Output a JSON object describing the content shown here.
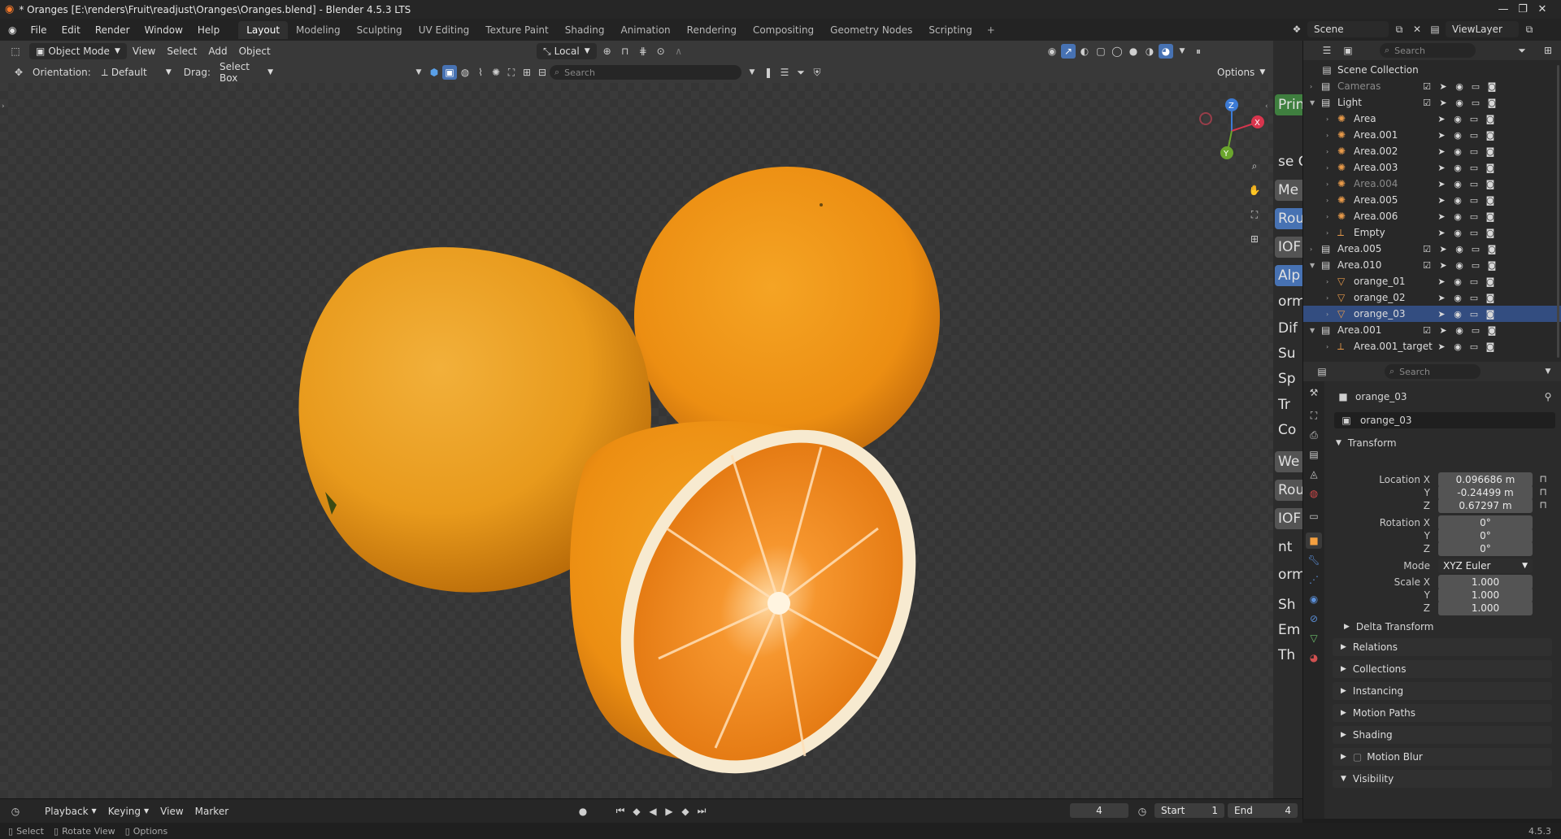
{
  "window": {
    "title": "* Oranges [E:\\renders\\Fruit\\readjust\\Oranges\\Oranges.blend] - Blender 4.5.3 LTS"
  },
  "menu": [
    "File",
    "Edit",
    "Render",
    "Window",
    "Help"
  ],
  "workspaces": [
    "Layout",
    "Modeling",
    "Sculpting",
    "UV Editing",
    "Texture Paint",
    "Shading",
    "Animation",
    "Rendering",
    "Compositing",
    "Geometry Nodes",
    "Scripting"
  ],
  "active_workspace": "Layout",
  "topright": {
    "scene": "Scene",
    "view_layer": "ViewLayer"
  },
  "viewport": {
    "mode": "Object Mode",
    "menus": [
      "View",
      "Select",
      "Add",
      "Object"
    ],
    "transform_space": "Local",
    "orientation_label": "Orientation:",
    "orientation": "Default",
    "drag_label": "Drag:",
    "drag": "Select Box",
    "search_placeholder": "Search",
    "options": "Options",
    "gizmo": {
      "x": "X",
      "y": "Y",
      "z": "Z"
    }
  },
  "npanel_tabs": [
    "Prin",
    "se C",
    "Me",
    "Rou",
    "IOF",
    "Alp",
    "orma",
    "Dif",
    "Su",
    "Sp",
    "Tr",
    "Co",
    "We",
    "Rou",
    "IOF",
    "nt",
    "orma",
    "Sh",
    "Em",
    "Th"
  ],
  "outliner": {
    "search_placeholder": "Search",
    "root": "Scene Collection",
    "rows": [
      {
        "label": "Cameras",
        "depth": 0,
        "kind": "collection",
        "dim": true
      },
      {
        "label": "Light",
        "depth": 0,
        "kind": "collection",
        "expanded": true
      },
      {
        "label": "Area",
        "depth": 1,
        "kind": "light"
      },
      {
        "label": "Area.001",
        "depth": 1,
        "kind": "light"
      },
      {
        "label": "Area.002",
        "depth": 1,
        "kind": "light"
      },
      {
        "label": "Area.003",
        "depth": 1,
        "kind": "light"
      },
      {
        "label": "Area.004",
        "depth": 1,
        "kind": "light",
        "dim": true
      },
      {
        "label": "Area.005",
        "depth": 1,
        "kind": "light"
      },
      {
        "label": "Area.006",
        "depth": 1,
        "kind": "light"
      },
      {
        "label": "Empty",
        "depth": 1,
        "kind": "empty"
      },
      {
        "label": "Area.005",
        "depth": 0,
        "kind": "collection"
      },
      {
        "label": "Area.010",
        "depth": 0,
        "kind": "collection",
        "expanded": true
      },
      {
        "label": "orange_01",
        "depth": 1,
        "kind": "mesh"
      },
      {
        "label": "orange_02",
        "depth": 1,
        "kind": "mesh"
      },
      {
        "label": "orange_03",
        "depth": 1,
        "kind": "mesh"
      },
      {
        "label": "Area.001",
        "depth": 0,
        "kind": "collection",
        "expanded": true
      },
      {
        "label": "Area.001_target",
        "depth": 1,
        "kind": "empty"
      }
    ]
  },
  "properties": {
    "search_placeholder": "Search",
    "object_name": "orange_03",
    "datablock": "orange_03",
    "section": "Transform",
    "location_label": "Location X",
    "location": [
      "0.096686 m",
      "-0.24499 m",
      "0.67297 m"
    ],
    "rotation_label": "Rotation X",
    "rotation": [
      "0°",
      "0°",
      "0°"
    ],
    "axis_labels": [
      "Y",
      "Z"
    ],
    "mode_label": "Mode",
    "mode": "XYZ Euler",
    "scale_label": "Scale X",
    "scale": [
      "1.000",
      "1.000",
      "1.000"
    ],
    "subpanels": [
      "Delta Transform",
      "Relations",
      "Collections",
      "Instancing",
      "Motion Paths",
      "Shading",
      "Motion Blur",
      "Visibility"
    ]
  },
  "timeline": {
    "menus": [
      "Playback",
      "Keying",
      "View",
      "Marker"
    ],
    "current_frame": "4",
    "start_label": "Start",
    "start": "1",
    "end_label": "End",
    "end": "4"
  },
  "status": {
    "select": "Select",
    "rotate": "Rotate View",
    "options": "Options",
    "version": "4.5.3"
  }
}
